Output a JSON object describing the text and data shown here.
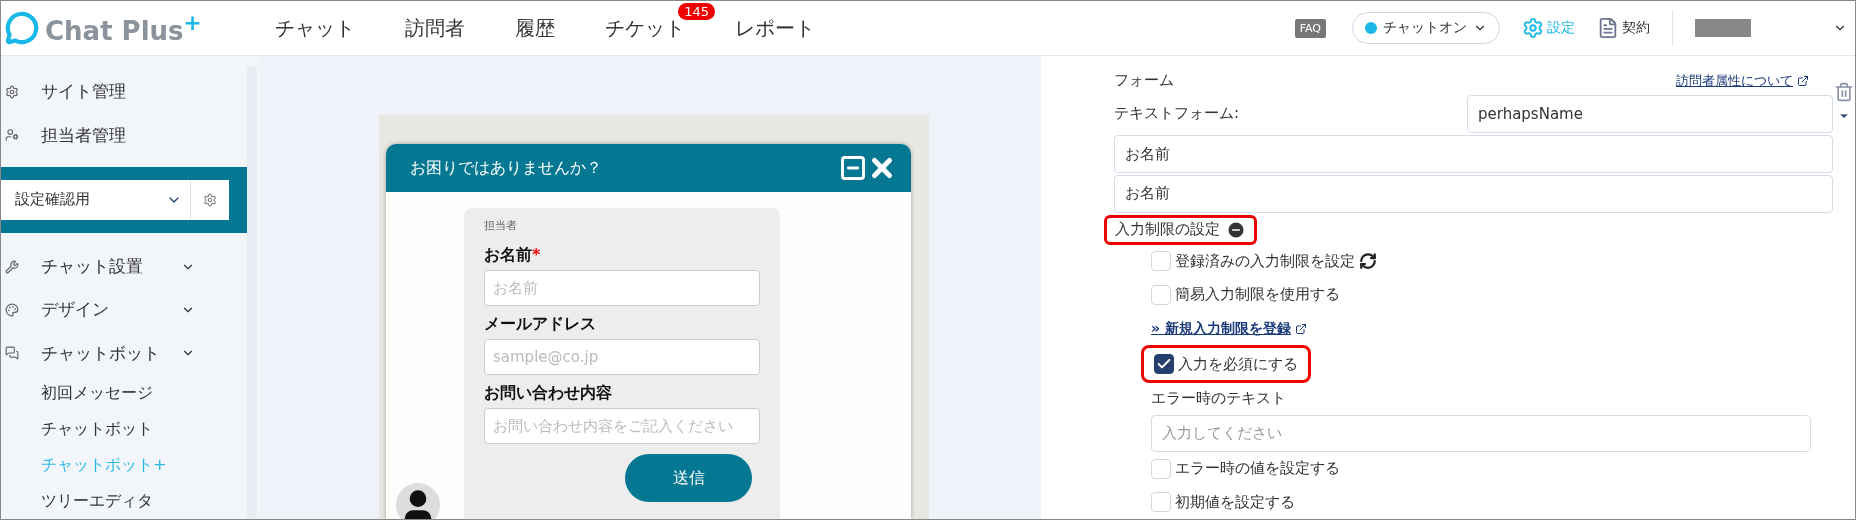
{
  "header": {
    "logo": {
      "name": "Chat Plus",
      "mark": "+"
    },
    "nav": [
      {
        "label": "チャット"
      },
      {
        "label": "訪問者"
      },
      {
        "label": "履歴"
      },
      {
        "label": "チケット",
        "badge": "145"
      },
      {
        "label": "レポート"
      }
    ],
    "faq": "FAQ",
    "status": {
      "label": "チャットオン",
      "on": true
    },
    "settings": "設定",
    "contract": "契約"
  },
  "sidebar": {
    "top_items": [
      {
        "kind": "site",
        "label": "サイト管理"
      },
      {
        "kind": "agent",
        "label": "担当者管理"
      }
    ],
    "site_select": "設定確認用",
    "menu": [
      {
        "kind": "install",
        "label": "チャット設置"
      },
      {
        "kind": "design",
        "label": "デザイン"
      },
      {
        "kind": "bot",
        "label": "チャットボット",
        "children": [
          {
            "label": "初回メッセージ",
            "selected": false
          },
          {
            "label": "チャットボット",
            "selected": false
          },
          {
            "label": "チャットボット+",
            "selected": true
          },
          {
            "label": "ツリーエディタ",
            "selected": false
          }
        ]
      }
    ]
  },
  "widget": {
    "title": "お困りではありませんか？",
    "agent_label": "担当者",
    "required_mark": "*",
    "fields": [
      {
        "label": "お名前",
        "required": true,
        "placeholder": "お名前"
      },
      {
        "label": "メールアドレス",
        "required": false,
        "placeholder": "sample@co.jp"
      },
      {
        "label": "お問い合わせ内容",
        "required": false,
        "placeholder": "お問い合わせ内容をご記入ください"
      }
    ],
    "submit": "送信"
  },
  "settings_panel": {
    "heading": "フォーム",
    "help_link": "訪問者属性について",
    "text_form_label": "テキストフォーム:",
    "variable": "perhapsName",
    "values": [
      "お名前",
      "お名前"
    ],
    "restriction": {
      "title": "入力制限の設定",
      "expanded": true,
      "highlighted": true,
      "items": [
        {
          "kind": "checkbox",
          "label": "登録済みの入力制限を設定",
          "checked": false,
          "refresh": true
        },
        {
          "kind": "checkbox",
          "label": "簡易入力制限を使用する",
          "checked": false,
          "refresh": false
        },
        {
          "kind": "link",
          "label": "» 新規入力制限を登録"
        }
      ]
    },
    "required": {
      "label": "入力を必須にする",
      "checked": true,
      "highlighted": true
    },
    "error_text": {
      "label": "エラー時のテキスト",
      "placeholder": "入力してください"
    },
    "more_options": [
      {
        "label": "エラー時の値を設定する",
        "checked": false
      },
      {
        "label": "初期値を設定する",
        "checked": false
      }
    ]
  }
}
